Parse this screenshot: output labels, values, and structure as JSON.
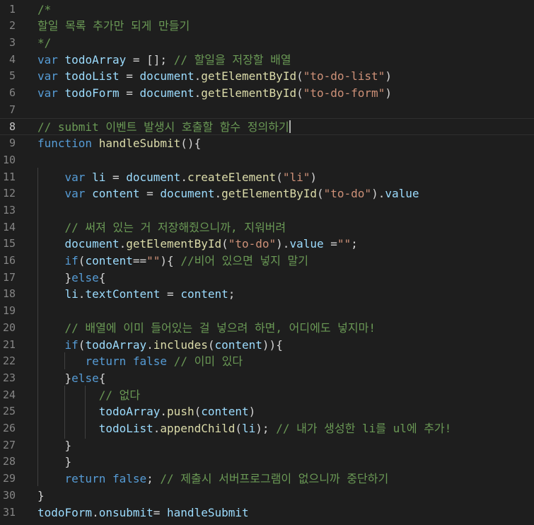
{
  "editor": {
    "colors": {
      "background": "#1e1e1e",
      "line_number": "#858585",
      "comment": "#6a9955",
      "keyword": "#569cd6",
      "variable": "#9cdcfe",
      "function": "#dcdcaa",
      "string": "#ce9178",
      "text": "#d4d4d4"
    },
    "active_line": 8,
    "lines": [
      {
        "n": "1",
        "tokens": [
          {
            "t": "/*",
            "c": "comment"
          }
        ]
      },
      {
        "n": "2",
        "tokens": [
          {
            "t": "할일 목록 추가만 되게 만들기",
            "c": "comment"
          }
        ]
      },
      {
        "n": "3",
        "tokens": [
          {
            "t": "*/",
            "c": "comment"
          }
        ]
      },
      {
        "n": "4",
        "tokens": [
          {
            "t": "var",
            "c": "keyword"
          },
          {
            "t": " ",
            "c": "plain"
          },
          {
            "t": "todoArray",
            "c": "var"
          },
          {
            "t": " = []; ",
            "c": "plain"
          },
          {
            "t": "// 할일을 저장할 배열",
            "c": "comment"
          }
        ]
      },
      {
        "n": "5",
        "tokens": [
          {
            "t": "var",
            "c": "keyword"
          },
          {
            "t": " ",
            "c": "plain"
          },
          {
            "t": "todoList",
            "c": "var"
          },
          {
            "t": " = ",
            "c": "plain"
          },
          {
            "t": "document",
            "c": "var"
          },
          {
            "t": ".",
            "c": "plain"
          },
          {
            "t": "getElementById",
            "c": "func"
          },
          {
            "t": "(",
            "c": "plain"
          },
          {
            "t": "\"to-do-list\"",
            "c": "string"
          },
          {
            "t": ")",
            "c": "plain"
          }
        ]
      },
      {
        "n": "6",
        "tokens": [
          {
            "t": "var",
            "c": "keyword"
          },
          {
            "t": " ",
            "c": "plain"
          },
          {
            "t": "todoForm",
            "c": "var"
          },
          {
            "t": " = ",
            "c": "plain"
          },
          {
            "t": "document",
            "c": "var"
          },
          {
            "t": ".",
            "c": "plain"
          },
          {
            "t": "getElementById",
            "c": "func"
          },
          {
            "t": "(",
            "c": "plain"
          },
          {
            "t": "\"to-do-form\"",
            "c": "string"
          },
          {
            "t": ")",
            "c": "plain"
          }
        ]
      },
      {
        "n": "7",
        "tokens": []
      },
      {
        "n": "8",
        "tokens": [
          {
            "t": "// submit 이벤트 발생시 호출할 함수 정의하기",
            "c": "comment"
          }
        ],
        "cursor": true
      },
      {
        "n": "9",
        "tokens": [
          {
            "t": "function",
            "c": "keyword"
          },
          {
            "t": " ",
            "c": "plain"
          },
          {
            "t": "handleSubmit",
            "c": "func"
          },
          {
            "t": "(){",
            "c": "plain"
          }
        ]
      },
      {
        "n": "10",
        "tokens": []
      },
      {
        "n": "11",
        "indent": "    ",
        "tokens": [
          {
            "t": "var",
            "c": "keyword"
          },
          {
            "t": " ",
            "c": "plain"
          },
          {
            "t": "li",
            "c": "var"
          },
          {
            "t": " = ",
            "c": "plain"
          },
          {
            "t": "document",
            "c": "var"
          },
          {
            "t": ".",
            "c": "plain"
          },
          {
            "t": "createElement",
            "c": "func"
          },
          {
            "t": "(",
            "c": "plain"
          },
          {
            "t": "\"li\"",
            "c": "string"
          },
          {
            "t": ")",
            "c": "plain"
          }
        ]
      },
      {
        "n": "12",
        "indent": "    ",
        "tokens": [
          {
            "t": "var",
            "c": "keyword"
          },
          {
            "t": " ",
            "c": "plain"
          },
          {
            "t": "content",
            "c": "var"
          },
          {
            "t": " = ",
            "c": "plain"
          },
          {
            "t": "document",
            "c": "var"
          },
          {
            "t": ".",
            "c": "plain"
          },
          {
            "t": "getElementById",
            "c": "func"
          },
          {
            "t": "(",
            "c": "plain"
          },
          {
            "t": "\"to-do\"",
            "c": "string"
          },
          {
            "t": ").",
            "c": "plain"
          },
          {
            "t": "value",
            "c": "var"
          }
        ]
      },
      {
        "n": "13",
        "tokens": []
      },
      {
        "n": "14",
        "indent": "    ",
        "tokens": [
          {
            "t": "// 써져 있는 거 저장해줬으니까, 지워버려",
            "c": "comment"
          }
        ]
      },
      {
        "n": "15",
        "indent": "    ",
        "tokens": [
          {
            "t": "document",
            "c": "var"
          },
          {
            "t": ".",
            "c": "plain"
          },
          {
            "t": "getElementById",
            "c": "func"
          },
          {
            "t": "(",
            "c": "plain"
          },
          {
            "t": "\"to-do\"",
            "c": "string"
          },
          {
            "t": ").",
            "c": "plain"
          },
          {
            "t": "value",
            "c": "var"
          },
          {
            "t": " =",
            "c": "plain"
          },
          {
            "t": "\"\"",
            "c": "string"
          },
          {
            "t": ";",
            "c": "plain"
          }
        ]
      },
      {
        "n": "16",
        "indent": "    ",
        "tokens": [
          {
            "t": "if",
            "c": "keyword"
          },
          {
            "t": "(",
            "c": "plain"
          },
          {
            "t": "content",
            "c": "var"
          },
          {
            "t": "==",
            "c": "plain"
          },
          {
            "t": "\"\"",
            "c": "string"
          },
          {
            "t": "){ ",
            "c": "plain"
          },
          {
            "t": "//비어 있으면 넣지 말기",
            "c": "comment"
          }
        ]
      },
      {
        "n": "17",
        "indent": "    ",
        "tokens": [
          {
            "t": "}",
            "c": "plain"
          },
          {
            "t": "else",
            "c": "keyword"
          },
          {
            "t": "{",
            "c": "plain"
          }
        ]
      },
      {
        "n": "18",
        "indent": "    ",
        "tokens": [
          {
            "t": "li",
            "c": "var"
          },
          {
            "t": ".",
            "c": "plain"
          },
          {
            "t": "textContent",
            "c": "var"
          },
          {
            "t": " = ",
            "c": "plain"
          },
          {
            "t": "content",
            "c": "var"
          },
          {
            "t": ";",
            "c": "plain"
          }
        ]
      },
      {
        "n": "19",
        "tokens": []
      },
      {
        "n": "20",
        "indent": "    ",
        "tokens": [
          {
            "t": "// 배열에 이미 들어있는 걸 넣으려 하면, 어디에도 넣지마!",
            "c": "comment"
          }
        ]
      },
      {
        "n": "21",
        "indent": "    ",
        "tokens": [
          {
            "t": "if",
            "c": "keyword"
          },
          {
            "t": "(",
            "c": "plain"
          },
          {
            "t": "todoArray",
            "c": "var"
          },
          {
            "t": ".",
            "c": "plain"
          },
          {
            "t": "includes",
            "c": "func"
          },
          {
            "t": "(",
            "c": "plain"
          },
          {
            "t": "content",
            "c": "var"
          },
          {
            "t": ")){",
            "c": "plain"
          }
        ]
      },
      {
        "n": "22",
        "indent": "       ",
        "tokens": [
          {
            "t": "return",
            "c": "keyword"
          },
          {
            "t": " ",
            "c": "plain"
          },
          {
            "t": "false",
            "c": "keyword"
          },
          {
            "t": " ",
            "c": "plain"
          },
          {
            "t": "// 이미 있다",
            "c": "comment"
          }
        ]
      },
      {
        "n": "23",
        "indent": "    ",
        "tokens": [
          {
            "t": "}",
            "c": "plain"
          },
          {
            "t": "else",
            "c": "keyword"
          },
          {
            "t": "{",
            "c": "plain"
          }
        ]
      },
      {
        "n": "24",
        "indent": "         ",
        "tokens": [
          {
            "t": "// 없다",
            "c": "comment"
          }
        ]
      },
      {
        "n": "25",
        "indent": "         ",
        "tokens": [
          {
            "t": "todoArray",
            "c": "var"
          },
          {
            "t": ".",
            "c": "plain"
          },
          {
            "t": "push",
            "c": "func"
          },
          {
            "t": "(",
            "c": "plain"
          },
          {
            "t": "content",
            "c": "var"
          },
          {
            "t": ")",
            "c": "plain"
          }
        ]
      },
      {
        "n": "26",
        "indent": "         ",
        "tokens": [
          {
            "t": "todoList",
            "c": "var"
          },
          {
            "t": ".",
            "c": "plain"
          },
          {
            "t": "appendChild",
            "c": "func"
          },
          {
            "t": "(",
            "c": "plain"
          },
          {
            "t": "li",
            "c": "var"
          },
          {
            "t": "); ",
            "c": "plain"
          },
          {
            "t": "// 내가 생성한 li를 ul에 추가!",
            "c": "comment"
          }
        ]
      },
      {
        "n": "27",
        "indent": "    ",
        "tokens": [
          {
            "t": "}",
            "c": "plain"
          }
        ]
      },
      {
        "n": "28",
        "indent": "    ",
        "tokens": [
          {
            "t": "}",
            "c": "plain"
          }
        ]
      },
      {
        "n": "29",
        "indent": "    ",
        "tokens": [
          {
            "t": "return",
            "c": "keyword"
          },
          {
            "t": " ",
            "c": "plain"
          },
          {
            "t": "false",
            "c": "keyword"
          },
          {
            "t": "; ",
            "c": "plain"
          },
          {
            "t": "// 제출시 서버프로그램이 없으니까 중단하기",
            "c": "comment"
          }
        ]
      },
      {
        "n": "30",
        "tokens": [
          {
            "t": "}",
            "c": "plain"
          }
        ]
      },
      {
        "n": "31",
        "tokens": [
          {
            "t": "todoForm",
            "c": "var"
          },
          {
            "t": ".",
            "c": "plain"
          },
          {
            "t": "onsubmit",
            "c": "var"
          },
          {
            "t": "= ",
            "c": "plain"
          },
          {
            "t": "handleSubmit",
            "c": "var"
          }
        ]
      }
    ]
  }
}
